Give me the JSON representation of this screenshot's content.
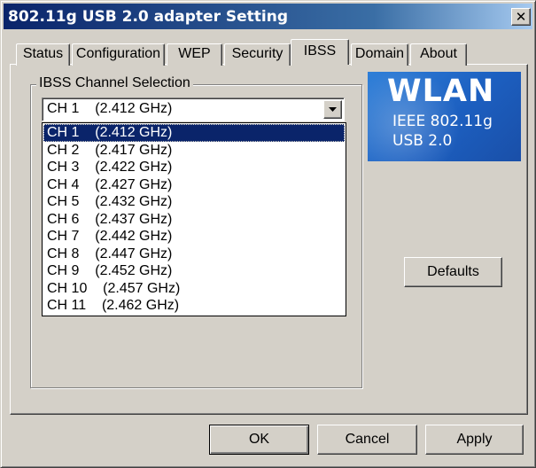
{
  "window": {
    "title": "802.11g USB 2.0 adapter Setting",
    "close_label": "✕"
  },
  "tabs": [
    {
      "label": "Status"
    },
    {
      "label": "Configuration"
    },
    {
      "label": "WEP"
    },
    {
      "label": "Security"
    },
    {
      "label": "IBSS",
      "active": true
    },
    {
      "label": "Domain"
    },
    {
      "label": "About"
    }
  ],
  "ibss": {
    "group_label": "IBSS Channel Selection",
    "selected_value": "CH 1    (2.412 GHz)",
    "options": [
      "CH 1    (2.412 GHz)",
      "CH 2    (2.417 GHz)",
      "CH 3    (2.422 GHz)",
      "CH 4    (2.427 GHz)",
      "CH 5    (2.432 GHz)",
      "CH 6    (2.437 GHz)",
      "CH 7    (2.442 GHz)",
      "CH 8    (2.447 GHz)",
      "CH 9    (2.452 GHz)",
      "CH 10    (2.457 GHz)",
      "CH 11    (2.462 GHz)"
    ],
    "selected_index": 0
  },
  "logo": {
    "brand": "WLAN",
    "line1": "IEEE 802.11g",
    "line2": "USB 2.0"
  },
  "buttons": {
    "defaults": "Defaults",
    "ok": "OK",
    "cancel": "Cancel",
    "apply": "Apply"
  },
  "colors": {
    "titlebar": "#0a246a",
    "face": "#d4d0c8",
    "selection": "#0a246a",
    "logo": "#1c5fc0"
  },
  "icons": {
    "dropdown": "chevron-down-icon",
    "close": "close-icon"
  }
}
